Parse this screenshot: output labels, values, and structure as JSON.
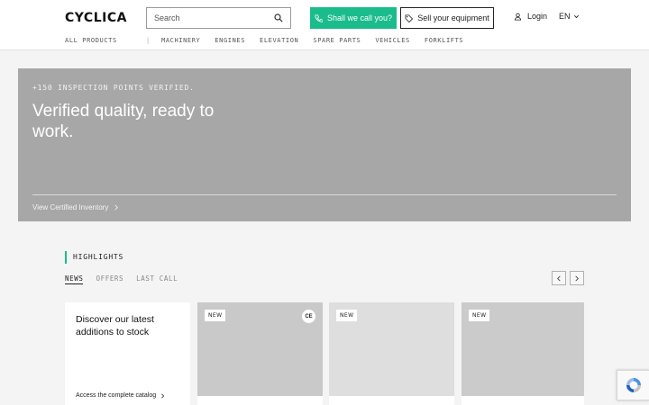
{
  "header": {
    "logo": "CYCLICA",
    "search": {
      "placeholder": "Search",
      "value": ""
    },
    "call_button": "Shall we call you?",
    "sell_button": "Sell your equipment",
    "login": "Login",
    "language": "EN"
  },
  "nav": {
    "all_products": "ALL PRODUCTS",
    "separator": "|",
    "items": [
      "MACHINERY",
      "ENGINES",
      "ELEVATION",
      "SPARE PARTS",
      "VEHICLES",
      "FORKLIFTS"
    ]
  },
  "hero": {
    "kicker": "+150 INSPECTION POINTS VERIFIED.",
    "title": "Verified quality, ready to work.",
    "cta": "View Certified Inventory"
  },
  "highlights": {
    "title": "HIGHLIGHTS",
    "tabs": [
      "NEWS",
      "OFFERS",
      "LAST CALL"
    ],
    "active_tab": "NEWS",
    "intro_text": "Discover our latest additions to stock",
    "intro_link": "Access the complete catalog",
    "cards": [
      {
        "badge": "NEW",
        "cert": "CE"
      },
      {
        "badge": "NEW"
      },
      {
        "badge": "NEW"
      }
    ]
  },
  "colors": {
    "accent": "#1abc8c",
    "hero_bg": "#a7a7a7",
    "card_bg_1": "#c9c9c9",
    "card_bg_2": "#dedede",
    "card_bg_3": "#cbcbcb"
  },
  "icons": [
    "search-icon",
    "phone-icon",
    "tag-icon",
    "user-icon",
    "chevron-down-icon",
    "chevron-right-icon",
    "chevron-left-icon",
    "recaptcha-icon"
  ]
}
